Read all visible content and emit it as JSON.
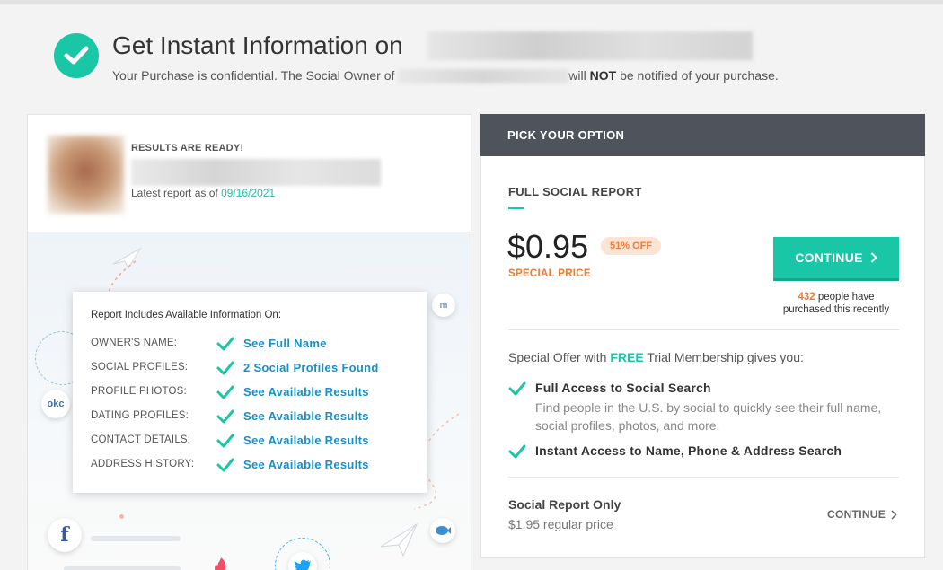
{
  "header": {
    "title": "Get Instant Information on",
    "subtitle_pre": "Your Purchase is confidential. The Social Owner of",
    "subtitle_not": "NOT",
    "subtitle_will": "will",
    "subtitle_post": "be notified of your purchase."
  },
  "profile": {
    "ready_label": "RESULTS ARE READY!",
    "latest_prefix": "Latest report as of",
    "latest_date": "09/16/2021"
  },
  "info": {
    "heading": "Report Includes Available Information On:",
    "rows": [
      {
        "label": "OWNER'S NAME:",
        "value": "See Full Name"
      },
      {
        "label": "SOCIAL PROFILES:",
        "value": "2 Social Profiles Found"
      },
      {
        "label": "PROFILE PHOTOS:",
        "value": "See Available Results"
      },
      {
        "label": "DATING PROFILES:",
        "value": "See Available Results"
      },
      {
        "label": "CONTACT DETAILS:",
        "value": "See Available Results"
      },
      {
        "label": "ADDRESS HISTORY:",
        "value": "See Available Results"
      }
    ]
  },
  "deco": {
    "okc": "okc",
    "facebook": "f",
    "badge": "m"
  },
  "options": {
    "header": "PICK YOUR OPTION",
    "plan_title": "FULL SOCIAL REPORT",
    "price": "$0.95",
    "discount": "51% OFF",
    "special": "SPECIAL PRICE",
    "continue_label": "CONTINUE",
    "purchased_count": "432",
    "purchased_text_1": "people have",
    "purchased_text_2": "purchased this recently",
    "offer_pre": "Special Offer with",
    "offer_free": "FREE",
    "offer_post": "Trial Membership gives you:",
    "features": [
      {
        "title": "Full Access to Social Search",
        "desc": "Find people in the U.S. by social to quickly see their full name, social profiles, photos, and more."
      },
      {
        "title": "Instant Access to Name, Phone & Address Search",
        "desc": ""
      }
    ],
    "alt_title": "Social Report Only",
    "alt_price": "$1.95 regular price",
    "alt_continue": "CONTINUE"
  },
  "colors": {
    "accent": "#19c6a5",
    "orange": "#f07a32",
    "link": "#1a8fc9",
    "dark_header": "#4f545c"
  }
}
